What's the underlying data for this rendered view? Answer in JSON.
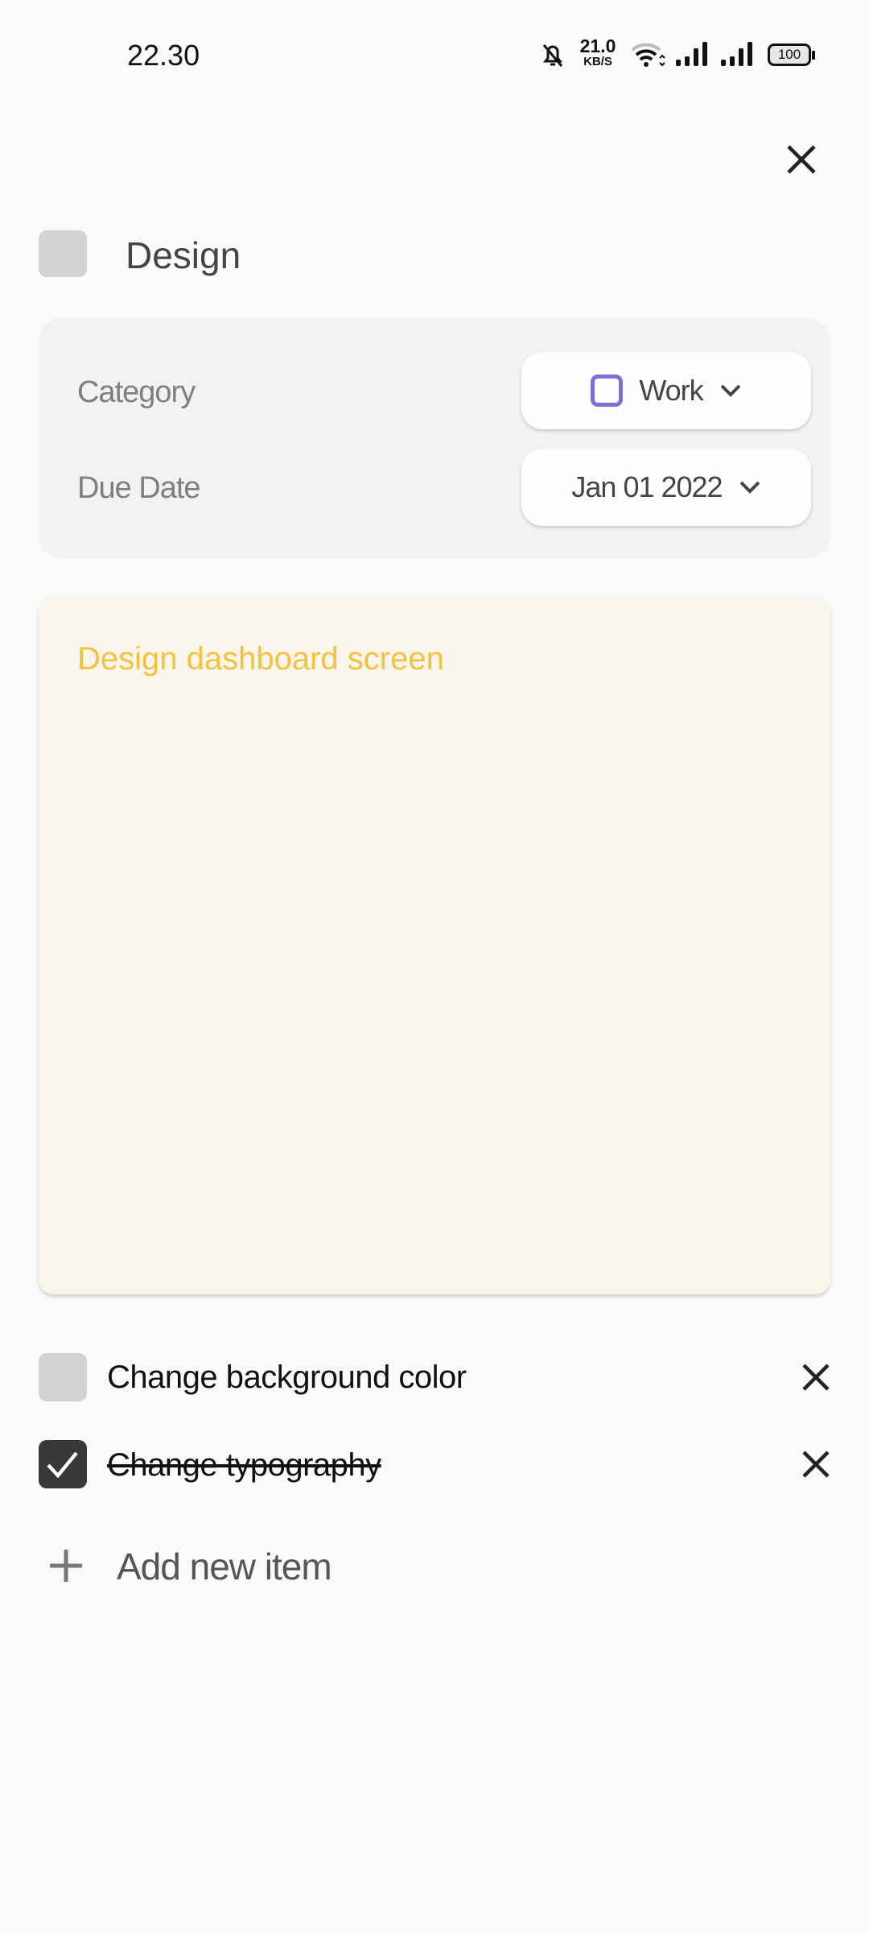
{
  "status_bar": {
    "time": "22.30",
    "net_speed": "21.0",
    "net_unit": "KB/S",
    "battery": "100"
  },
  "header": {
    "title": "Design"
  },
  "meta": {
    "category_label": "Category",
    "category_value": "Work",
    "category_color": "#7b6fd8",
    "due_label": "Due Date",
    "due_value": "Jan 01 2022"
  },
  "note": {
    "text": "Design dashboard screen",
    "text_color": "#f3c243"
  },
  "checklist": [
    {
      "label": "Change background color",
      "checked": false
    },
    {
      "label": "Change typography",
      "checked": true
    }
  ],
  "add_item_label": "Add new item"
}
